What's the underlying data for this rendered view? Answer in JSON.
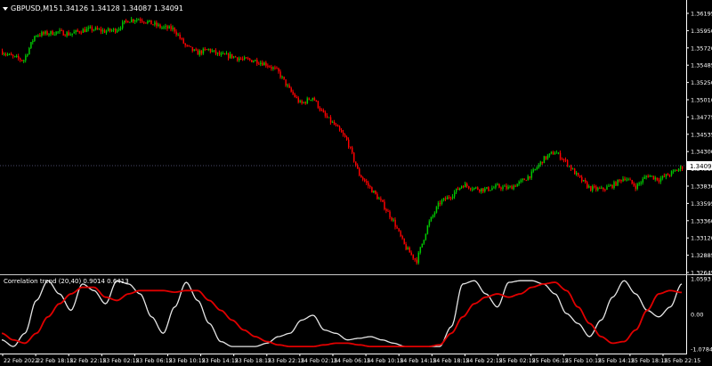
{
  "chart_header": {
    "title": "GBPUSD,M15",
    "ohlc_values": "1.34126 1.34128 1.34087 1.34091"
  },
  "indicator_header": {
    "title": "Correlation trend (20,40) 0.9014 0.6413"
  },
  "colors": {
    "background": "#000000",
    "up_candle": "#00c800",
    "down_candle": "#ff0000",
    "axis": "#ffffff",
    "price_marker_bg": "#ffffff",
    "fast_line": "#e6e6e6",
    "slow_line": "#e00000"
  },
  "price_axis": {
    "labels": [
      "1.36195",
      "1.35950",
      "1.35720",
      "1.35485",
      "1.35250",
      "1.35010",
      "1.34775",
      "1.34535",
      "1.34300",
      "1.34060",
      "1.33830",
      "1.33595",
      "1.33360",
      "1.33120",
      "1.32885",
      "1.32645"
    ],
    "current_price": "1.34091"
  },
  "indicator_axis": {
    "labels": [
      "1.0593",
      "0.00",
      "-1.0784"
    ]
  },
  "time_axis": {
    "labels": [
      "22 Feb 2022",
      "22 Feb 18:15",
      "22 Feb 22:15",
      "23 Feb 02:15",
      "23 Feb 06:15",
      "23 Feb 10:15",
      "23 Feb 14:15",
      "23 Feb 18:15",
      "23 Feb 22:15",
      "24 Feb 02:15",
      "24 Feb 06:15",
      "24 Feb 10:15",
      "24 Feb 14:15",
      "24 Feb 18:15",
      "24 Feb 22:15",
      "25 Feb 02:15",
      "25 Feb 06:15",
      "25 Feb 10:15",
      "25 Feb 14:15",
      "25 Feb 18:15",
      "25 Feb 22:15"
    ]
  },
  "chart_data": [
    {
      "type": "candlestick",
      "symbol": "GBPUSD",
      "timeframe": "M15",
      "ylim": [
        1.32645,
        1.36195
      ],
      "price_path_close": [
        1.3568,
        1.356,
        1.3555,
        1.359,
        1.3592,
        1.3594,
        1.3591,
        1.3596,
        1.3598,
        1.3595,
        1.3597,
        1.361,
        1.3612,
        1.3606,
        1.36,
        1.3598,
        1.3575,
        1.3565,
        1.357,
        1.3562,
        1.3561,
        1.3556,
        1.3555,
        1.355,
        1.354,
        1.3515,
        1.3495,
        1.3505,
        1.348,
        1.3465,
        1.3445,
        1.34,
        1.338,
        1.336,
        1.3335,
        1.33,
        1.328,
        1.333,
        1.336,
        1.337,
        1.3385,
        1.338,
        1.3378,
        1.3382,
        1.338,
        1.3388,
        1.34,
        1.342,
        1.343,
        1.3415,
        1.3395,
        1.338,
        1.3378,
        1.3384,
        1.3395,
        1.3382,
        1.3398,
        1.3392,
        1.34,
        1.3409
      ]
    },
    {
      "type": "line",
      "title": "Correlation trend (20,40) 0.9014 0.6413",
      "ylim": [
        -1.0784,
        1.0593
      ],
      "series": [
        {
          "values": [
            -0.8,
            -1.0,
            -0.6,
            0.4,
            1.0,
            0.6,
            0.1,
            0.9,
            0.7,
            0.3,
            1.0,
            0.9,
            0.6,
            -0.1,
            -0.6,
            0.2,
            0.95,
            0.4,
            -0.3,
            -0.85,
            -1.0,
            -1.0,
            -1.0,
            -0.9,
            -0.7,
            -0.6,
            -0.2,
            -0.05,
            -0.5,
            -0.6,
            -0.8,
            -0.75,
            -0.7,
            -0.8,
            -0.9,
            -1.0,
            -1.0,
            -1.0,
            -1.0,
            -0.4,
            0.9,
            1.0,
            0.6,
            0.2,
            0.95,
            1.0,
            1.0,
            0.9,
            0.6,
            0.0,
            -0.3,
            -0.7,
            -0.2,
            0.5,
            1.0,
            0.6,
            0.1,
            -0.1,
            0.2,
            0.9014
          ]
        },
        {
          "values": [
            -0.6,
            -0.8,
            -0.9,
            -0.6,
            -0.1,
            0.3,
            0.6,
            0.8,
            0.8,
            0.5,
            0.4,
            0.6,
            0.7,
            0.7,
            0.7,
            0.65,
            0.7,
            0.7,
            0.4,
            0.1,
            -0.2,
            -0.5,
            -0.7,
            -0.85,
            -0.95,
            -1.0,
            -1.0,
            -1.0,
            -0.95,
            -0.9,
            -0.9,
            -0.95,
            -1.0,
            -1.0,
            -1.0,
            -1.0,
            -1.0,
            -1.0,
            -0.95,
            -0.6,
            -0.1,
            0.3,
            0.5,
            0.6,
            0.5,
            0.6,
            0.8,
            0.9,
            0.95,
            0.7,
            0.2,
            -0.3,
            -0.7,
            -0.9,
            -0.85,
            -0.5,
            0.1,
            0.6,
            0.7,
            0.6413
          ]
        }
      ]
    }
  ]
}
